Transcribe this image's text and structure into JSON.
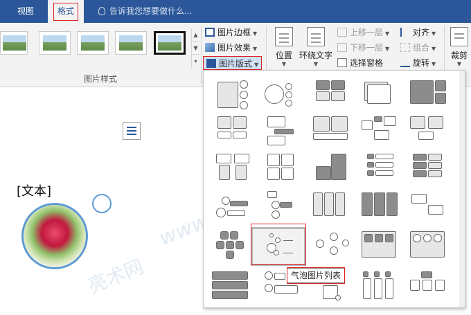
{
  "tabs": {
    "view": "视图",
    "format": "格式"
  },
  "tell_me": {
    "placeholder": "告诉我您想要做什么..."
  },
  "picture_styles": {
    "group_label": "图片样式"
  },
  "commands": {
    "picture_border": "图片边框",
    "picture_effects": "图片效果",
    "picture_layout": "图片版式",
    "position": "位置",
    "wrap_text": "环绕文字",
    "bring_forward": "上移一层",
    "send_backward": "下移一层",
    "selection_pane": "选择窗格",
    "align": "对齐",
    "group": "组合",
    "rotate": "旋转",
    "crop": "裁剪"
  },
  "document": {
    "text": "[文本]"
  },
  "tooltip": {
    "text": "气泡图片列表"
  },
  "watermark": {
    "url": "www.liangshunet",
    "brand": "亮术网"
  },
  "colors": {
    "accent": "#2b579a",
    "highlight_red": "#e02020",
    "shape_blue": "#5b9bd5"
  }
}
